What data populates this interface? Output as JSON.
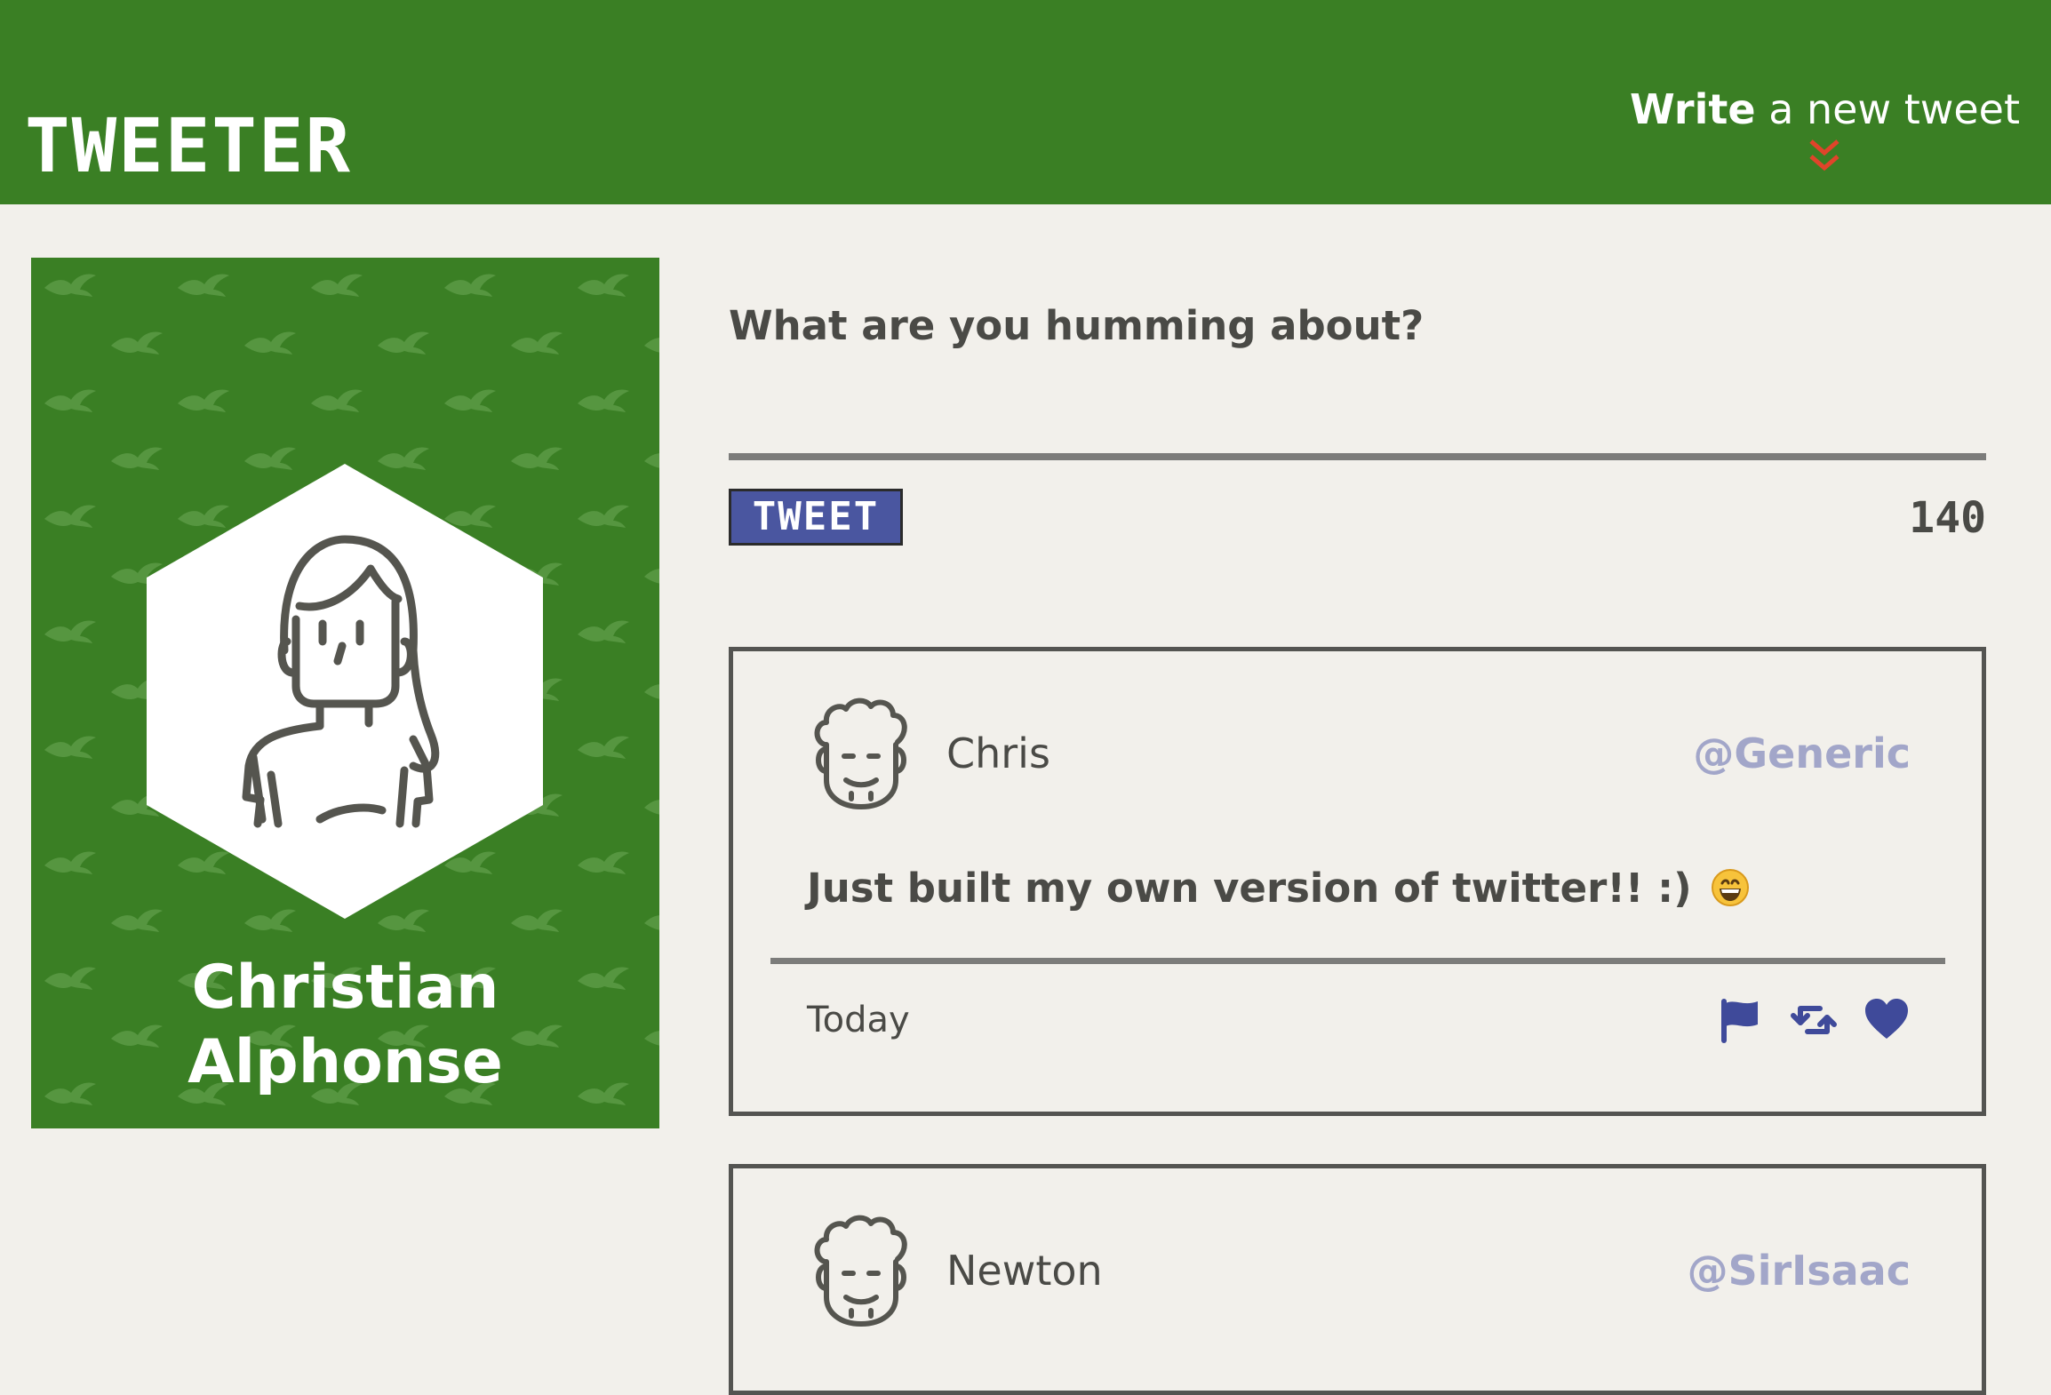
{
  "nav": {
    "brand": "TWEETER",
    "compose_toggle": {
      "bold": "Write",
      "rest": "a new tweet",
      "icon": "double-chevron-down-icon",
      "icon_color": "#e0442a"
    }
  },
  "profile": {
    "name_line1": "Christian",
    "name_line2": "Alphonse",
    "avatar_icon": "user-avatar-icon",
    "pattern_icon": "bird-icon",
    "background_color": "#3a7f24"
  },
  "compose": {
    "placeholder": "What are you humming about?",
    "value": "",
    "button_label": "TWEET",
    "counter": "140"
  },
  "tweets": [
    {
      "author": "Chris",
      "handle": "@Generic",
      "content": "Just built my own version of twitter!! :)",
      "emoji": "grinning-face-emoji",
      "date": "Today",
      "actions": [
        "flag-icon",
        "retweet-icon",
        "heart-icon"
      ]
    },
    {
      "author": "Newton",
      "handle": "@SirIsaac"
    }
  ],
  "colors": {
    "nav_bg": "#3a7f24",
    "page_bg": "#f2f0eb",
    "accent_blue": "#4a56a0",
    "handle": "#a2a6c9",
    "text": "#4a4a46"
  }
}
